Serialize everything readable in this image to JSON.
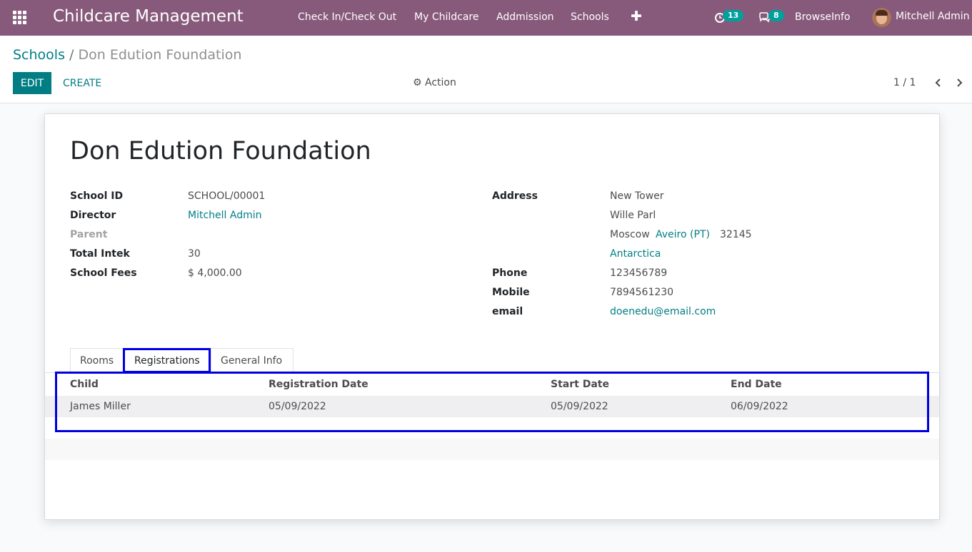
{
  "navbar": {
    "app_title": "Childcare Management",
    "menus": [
      "Check In/Check Out",
      "My Childcare",
      "Addmission",
      "Schools"
    ],
    "activity_count": "13",
    "message_count": "8",
    "browseinfo": "BrowseInfo",
    "user_name": "Mitchell Admin",
    "accent_color": "#875a7b"
  },
  "breadcrumb": {
    "parent": "Schools",
    "separator": "/",
    "current": "Don Edution Foundation"
  },
  "toolbar": {
    "edit_label": "EDIT",
    "create_label": "CREATE",
    "action_label": "Action",
    "pager": "1 / 1"
  },
  "record": {
    "title": "Don Edution Foundation",
    "left_fields": [
      {
        "label": "School ID",
        "value": "SCHOOL/00001"
      },
      {
        "label": "Director",
        "value": "Mitchell Admin"
      },
      {
        "label": "Parent",
        "value": ""
      },
      {
        "label": "Total Intek",
        "value": "30"
      },
      {
        "label": "School Fees",
        "value": "$ 4,000.00"
      }
    ],
    "address": {
      "label": "Address",
      "street": "New Tower",
      "street2": "Wille Parl",
      "city": "Moscow",
      "state": "Aveiro (PT)",
      "zip": "32145",
      "country": "Antarctica"
    },
    "right_fields": [
      {
        "label": "Phone",
        "value": "123456789"
      },
      {
        "label": "Mobile",
        "value": "7894561230"
      },
      {
        "label": "email",
        "value": "doenedu@email.com"
      }
    ]
  },
  "tabs": [
    "Rooms",
    "Registrations",
    "General Info"
  ],
  "registrations": {
    "columns": [
      "Child",
      "Registration Date",
      "Start Date",
      "End Date"
    ],
    "rows": [
      {
        "child": "James Miller",
        "registration_date": "05/09/2022",
        "start_date": "05/09/2022",
        "end_date": "06/09/2022"
      }
    ]
  }
}
